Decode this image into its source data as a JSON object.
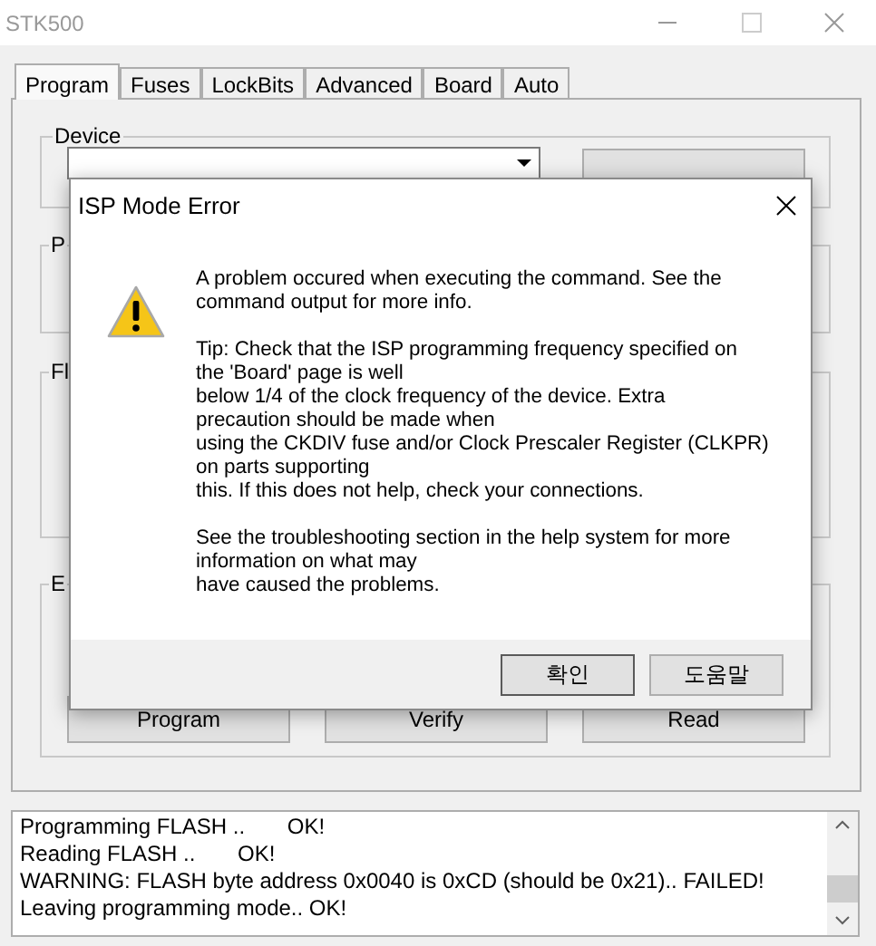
{
  "window": {
    "title": "STK500"
  },
  "tabs": [
    {
      "label": "Program",
      "selected": true
    },
    {
      "label": "Fuses",
      "selected": false
    },
    {
      "label": "LockBits",
      "selected": false
    },
    {
      "label": "Advanced",
      "selected": false
    },
    {
      "label": "Board",
      "selected": false
    },
    {
      "label": "Auto",
      "selected": false
    }
  ],
  "device_group": {
    "label": "Device"
  },
  "groups": [
    {
      "label": "P"
    },
    {
      "label": "Fl"
    },
    {
      "label": "E"
    }
  ],
  "action_buttons": [
    "Program",
    "Verify",
    "Read"
  ],
  "log": {
    "lines": [
      "Programming FLASH ..       OK!",
      "Reading FLASH ..       OK!",
      "WARNING: FLASH byte address 0x0040 is 0xCD (should be 0x21).. FAILED!",
      "Leaving programming mode.. OK!"
    ]
  },
  "dialog": {
    "title": "ISP Mode Error",
    "paragraphs": [
      "A problem occured when executing the command. See the\ncommand output for more info.",
      "Tip: Check that the ISP programming frequency specified on\nthe 'Board' page is well\nbelow 1/4 of the clock frequency of the device. Extra\nprecaution should be made when\nusing the CKDIV fuse and/or Clock Prescaler Register (CLKPR)\non parts supporting\nthis. If this does not help, check your connections.",
      "See the troubleshooting section in the help system for more\ninformation on what may\nhave caused the problems."
    ],
    "buttons": [
      {
        "label": "확인",
        "default": true
      },
      {
        "label": "도움말",
        "default": false
      }
    ]
  }
}
